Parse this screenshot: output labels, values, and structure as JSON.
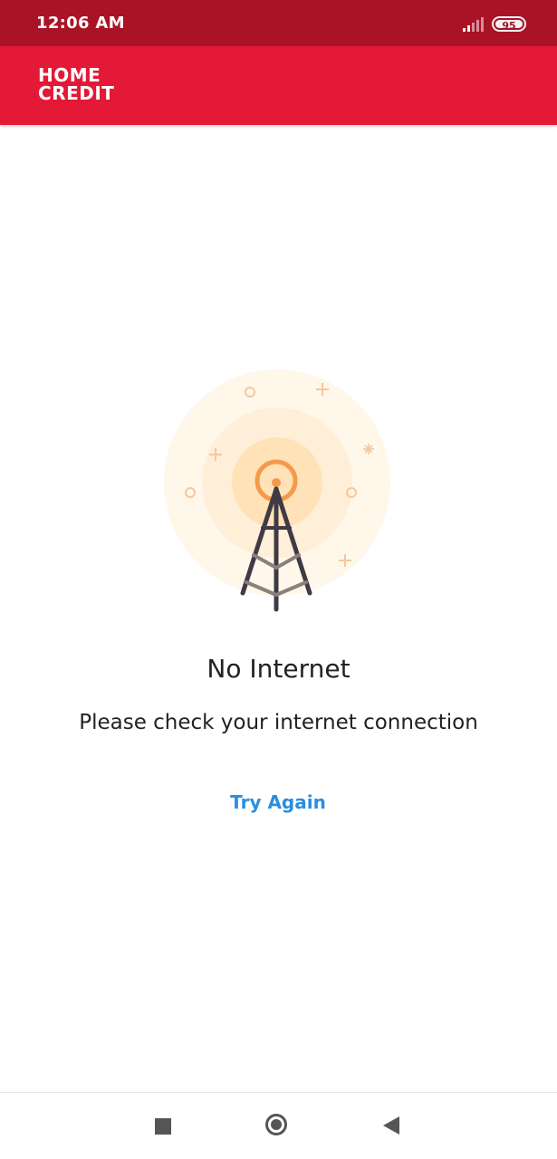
{
  "status_bar": {
    "time": "12:06 AM",
    "battery_level": "95",
    "signal_icon": "signal-icon",
    "battery_icon": "battery-icon",
    "bg_color": "#a91325"
  },
  "app_bar": {
    "logo_line1": "HOME",
    "logo_line2": "CREDIT",
    "bg_color": "#e31937"
  },
  "error": {
    "illustration_icon": "cell-tower-icon",
    "title": "No Internet",
    "message": "Please check your internet connection",
    "action_label": "Try Again",
    "action_color": "#2a8ee0"
  },
  "nav_bar": {
    "recent_icon": "recent-apps-icon",
    "home_icon": "home-icon",
    "back_icon": "back-icon"
  }
}
